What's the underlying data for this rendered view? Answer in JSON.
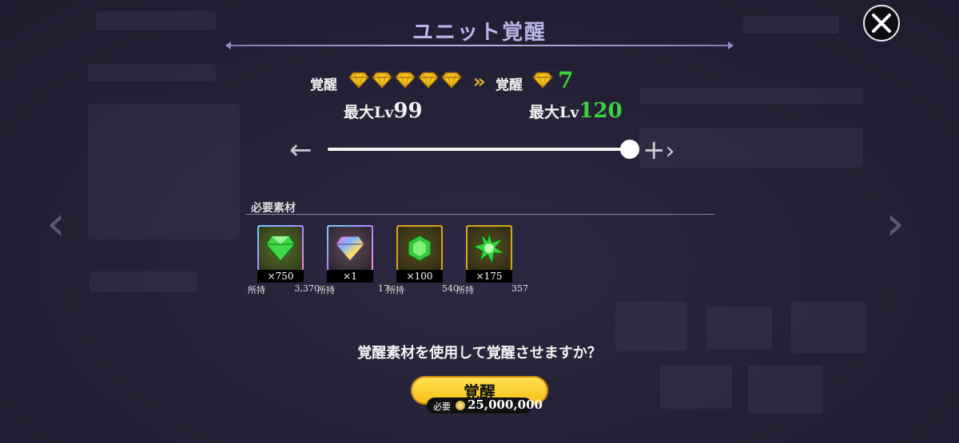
{
  "dialog": {
    "title": "ユニット覚醒",
    "current": {
      "label": "覚醒",
      "stars": 5,
      "max_lv_label": "最大Lv",
      "max_lv": "99"
    },
    "next": {
      "label": "覚醒",
      "stars": "7",
      "max_lv_label": "最大Lv",
      "max_lv": "120"
    },
    "slider": {
      "minus_symbol": "←",
      "plus_symbol": "+",
      "level_fraction": 1.0
    },
    "materials_label": "必要素材",
    "materials": [
      {
        "icon": "green-diamond-icon",
        "count": "×750",
        "own_label": "所持",
        "own_value": "3,370"
      },
      {
        "icon": "rainbow-diamond-icon",
        "count": "×1",
        "own_label": "所持",
        "own_value": "17"
      },
      {
        "icon": "green-gem-icon",
        "count": "×100",
        "own_label": "所持",
        "own_value": "540"
      },
      {
        "icon": "green-star-crystal-icon",
        "count": "×175",
        "own_label": "所持",
        "own_value": "357"
      }
    ],
    "question": "覚醒素材を使用して覚醒させますか？",
    "button_label": "覚醒",
    "cost_label": "必要",
    "cost_amount": "25,000,000"
  },
  "colors": {
    "accent_gold": "#f4bd14",
    "level_green": "#3ed23e",
    "title_lavender": "#b9b6e6"
  }
}
